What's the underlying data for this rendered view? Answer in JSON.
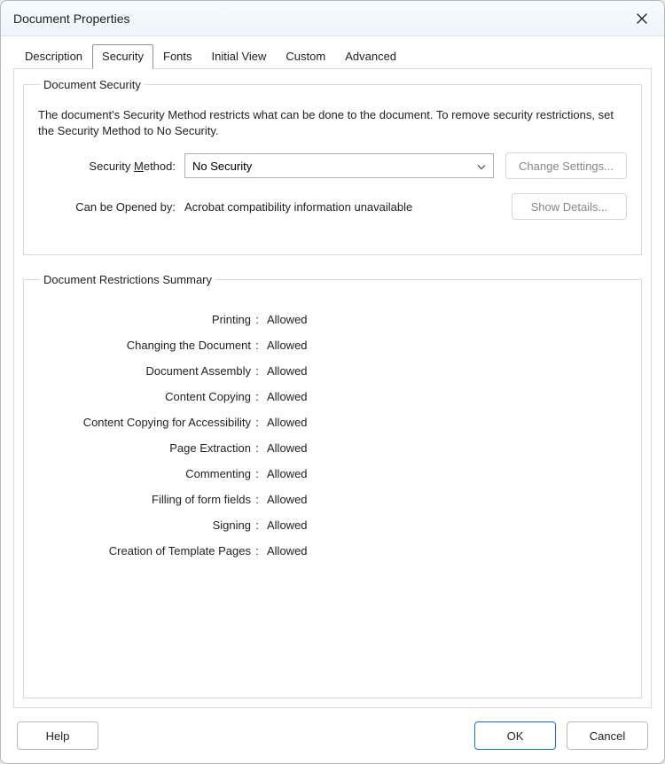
{
  "title": "Document Properties",
  "tabs": [
    {
      "label": "Description",
      "active": false
    },
    {
      "label": "Security",
      "active": true
    },
    {
      "label": "Fonts",
      "active": false
    },
    {
      "label": "Initial View",
      "active": false
    },
    {
      "label": "Custom",
      "active": false
    },
    {
      "label": "Advanced",
      "active": false
    }
  ],
  "securityGroup": {
    "legend": "Document Security",
    "intro": "The document's Security Method restricts what can be done to the document. To remove security restrictions, set the Security Method to No Security.",
    "methodLabelPre": "Security ",
    "methodLabelU": "M",
    "methodLabelPost": "ethod:",
    "methodValue": "No Security",
    "changeSettings": "Change Settings...",
    "openLabel": "Can be Opened by:",
    "openValue": "Acrobat compatibility information unavailable",
    "showDetails": "Show Details..."
  },
  "restrictionsGroup": {
    "legend": "Document Restrictions Summary",
    "rows": [
      {
        "label": "Printing",
        "value": "Allowed"
      },
      {
        "label": "Changing the Document",
        "value": "Allowed"
      },
      {
        "label": "Document Assembly",
        "value": "Allowed"
      },
      {
        "label": "Content Copying",
        "value": "Allowed"
      },
      {
        "label": "Content Copying for Accessibility",
        "value": "Allowed"
      },
      {
        "label": "Page Extraction",
        "value": "Allowed"
      },
      {
        "label": "Commenting",
        "value": "Allowed"
      },
      {
        "label": "Filling of form fields",
        "value": "Allowed"
      },
      {
        "label": "Signing",
        "value": "Allowed"
      },
      {
        "label": "Creation of Template Pages",
        "value": "Allowed"
      }
    ]
  },
  "footer": {
    "help": "Help",
    "ok": "OK",
    "cancel": "Cancel"
  }
}
